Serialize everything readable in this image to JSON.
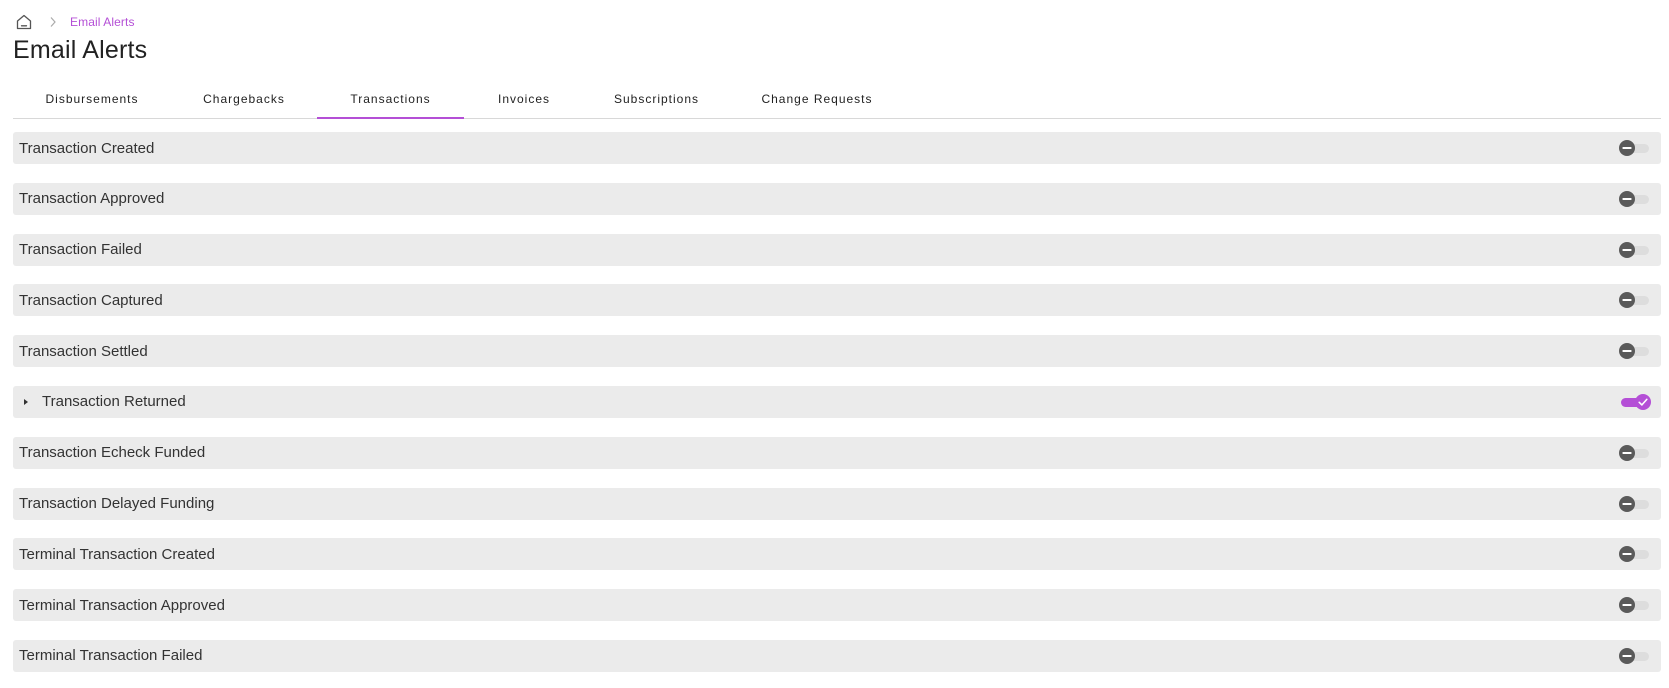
{
  "breadcrumb": {
    "home_icon": "home-icon",
    "separator_icon": "chevron-right-icon",
    "current": "Email Alerts"
  },
  "page_title": "Email Alerts",
  "accent_color": "#b44fd6",
  "tabs": [
    {
      "label": "Disbursements",
      "active": false
    },
    {
      "label": "Chargebacks",
      "active": false
    },
    {
      "label": "Transactions",
      "active": true
    },
    {
      "label": "Invoices",
      "active": false
    },
    {
      "label": "Subscriptions",
      "active": false
    },
    {
      "label": "Change Requests",
      "active": false
    }
  ],
  "alerts": [
    {
      "label": "Transaction Created",
      "enabled": false,
      "expandable": false
    },
    {
      "label": "Transaction Approved",
      "enabled": false,
      "expandable": false
    },
    {
      "label": "Transaction Failed",
      "enabled": false,
      "expandable": false
    },
    {
      "label": "Transaction Captured",
      "enabled": false,
      "expandable": false
    },
    {
      "label": "Transaction Settled",
      "enabled": false,
      "expandable": false
    },
    {
      "label": "Transaction Returned",
      "enabled": true,
      "expandable": true
    },
    {
      "label": "Transaction Echeck Funded",
      "enabled": false,
      "expandable": false
    },
    {
      "label": "Transaction Delayed Funding",
      "enabled": false,
      "expandable": false
    },
    {
      "label": "Terminal Transaction Created",
      "enabled": false,
      "expandable": false
    },
    {
      "label": "Terminal Transaction Approved",
      "enabled": false,
      "expandable": false
    },
    {
      "label": "Terminal Transaction Failed",
      "enabled": false,
      "expandable": false
    }
  ]
}
